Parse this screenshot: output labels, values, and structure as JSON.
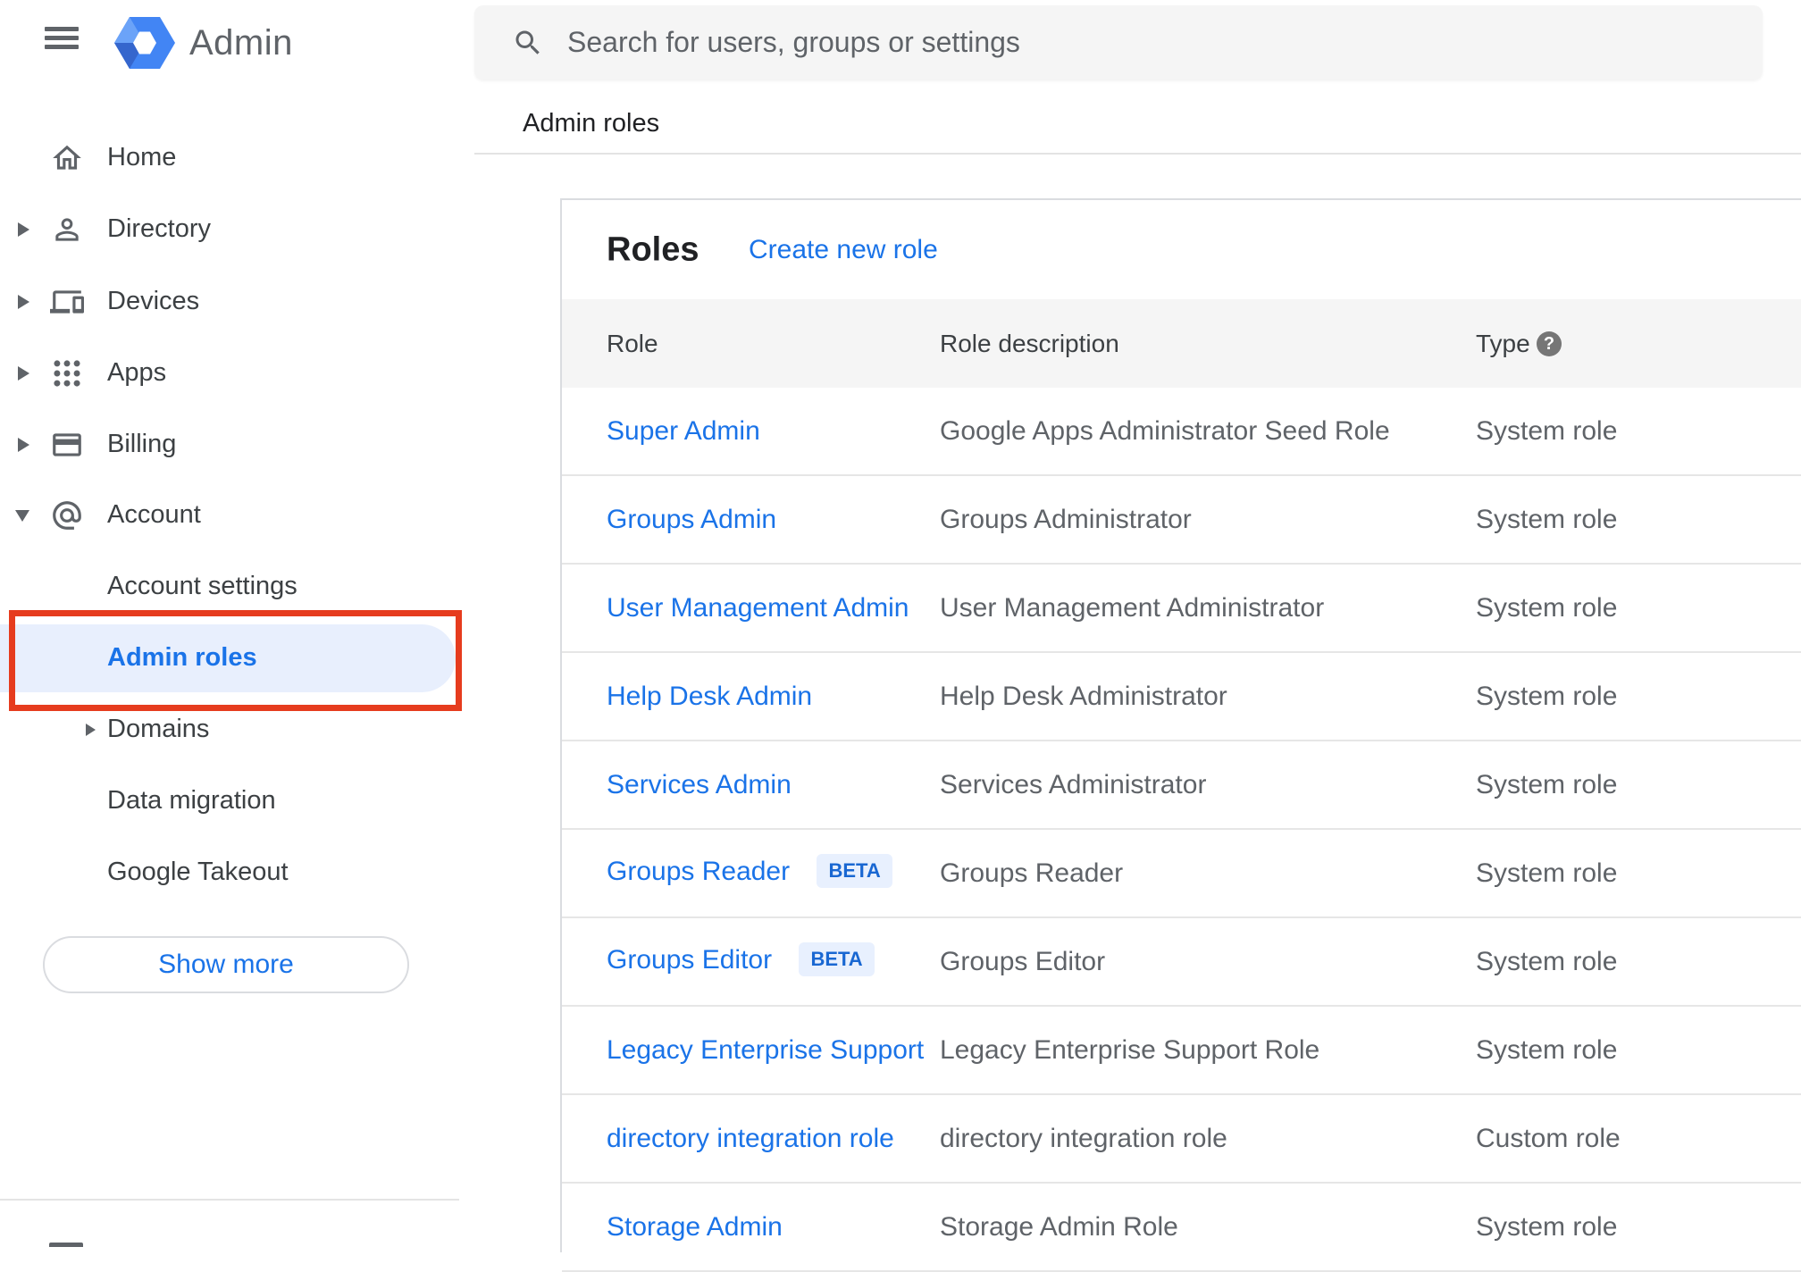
{
  "header": {
    "app_name": "Admin"
  },
  "search": {
    "placeholder": "Search for users, groups or settings"
  },
  "breadcrumb": {
    "label": "Admin roles"
  },
  "sidebar": {
    "items": [
      {
        "label": "Home"
      },
      {
        "label": "Directory"
      },
      {
        "label": "Devices"
      },
      {
        "label": "Apps"
      },
      {
        "label": "Billing"
      },
      {
        "label": "Account"
      }
    ],
    "subitems": [
      {
        "label": "Account settings"
      },
      {
        "label": "Admin roles",
        "selected": true
      },
      {
        "label": "Domains"
      },
      {
        "label": "Data migration"
      },
      {
        "label": "Google Takeout"
      }
    ],
    "show_more": "Show more"
  },
  "panel": {
    "title": "Roles",
    "create_link": "Create new role",
    "columns": {
      "role": "Role",
      "description": "Role description",
      "type": "Type"
    },
    "beta_label": "BETA",
    "rows": [
      {
        "role": "Super Admin",
        "description": "Google Apps Administrator Seed Role",
        "type": "System role",
        "beta": false
      },
      {
        "role": "Groups Admin",
        "description": "Groups Administrator",
        "type": "System role",
        "beta": false
      },
      {
        "role": "User Management Admin",
        "description": "User Management Administrator",
        "type": "System role",
        "beta": false
      },
      {
        "role": "Help Desk Admin",
        "description": "Help Desk Administrator",
        "type": "System role",
        "beta": false
      },
      {
        "role": "Services Admin",
        "description": "Services Administrator",
        "type": "System role",
        "beta": false
      },
      {
        "role": "Groups Reader",
        "description": "Groups Reader",
        "type": "System role",
        "beta": true
      },
      {
        "role": "Groups Editor",
        "description": "Groups Editor",
        "type": "System role",
        "beta": true
      },
      {
        "role": "Legacy Enterprise Support",
        "description": "Legacy Enterprise Support Role",
        "type": "System role",
        "beta": false
      },
      {
        "role": "directory integration role",
        "description": "directory integration role",
        "type": "Custom role",
        "beta": false
      },
      {
        "role": "Storage Admin",
        "description": "Storage Admin Role",
        "type": "System role",
        "beta": false
      }
    ]
  },
  "colors": {
    "accent_blue": "#1a73e8",
    "annotation_red": "#e63c1e",
    "selected_item_bg": "#e8effd",
    "beta_bg": "#e8f0fe",
    "beta_text": "#1967d2",
    "header_row_bg": "#f5f5f5"
  }
}
